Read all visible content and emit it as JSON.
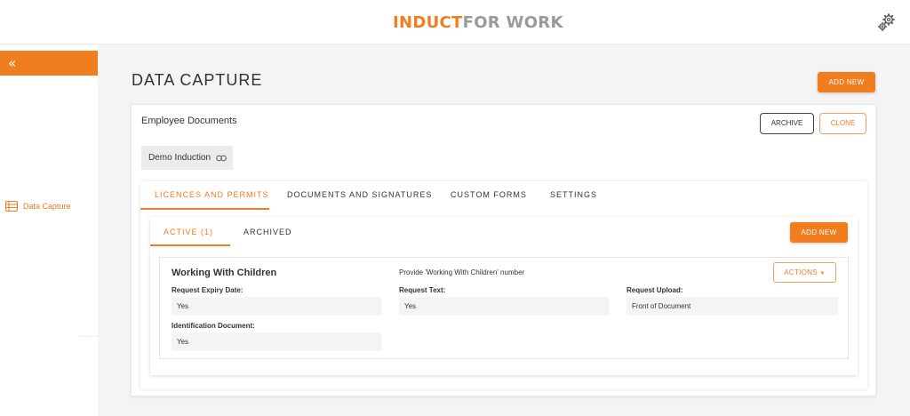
{
  "header": {
    "logo_part1": "INDUCT",
    "logo_part2": "FOR WORK",
    "settings_icon": "gears-icon"
  },
  "sidebar": {
    "collapse_glyph": "«",
    "items": [
      {
        "label": "Data Capture",
        "icon": "list-icon"
      }
    ]
  },
  "page": {
    "title": "DATA CAPTURE",
    "add_new_label": "ADD NEW"
  },
  "card": {
    "title": "Employee Documents",
    "archive_label": "ARCHIVE",
    "clone_label": "CLONE",
    "chip_label": "Demo Induction",
    "chip_icon": "link-icon"
  },
  "tabs": [
    {
      "label": "LICENCES AND PERMITS",
      "active": true
    },
    {
      "label": "DOCUMENTS AND SIGNATURES",
      "active": false
    },
    {
      "label": "CUSTOM FORMS",
      "active": false
    },
    {
      "label": "SETTINGS",
      "active": false
    }
  ],
  "subtabs": [
    {
      "label": "ACTIVE  (1)",
      "active": true
    },
    {
      "label": "ARCHIVED",
      "active": false
    }
  ],
  "subpanel": {
    "add_new_label": "ADD NEW"
  },
  "item": {
    "title": "Working With Children",
    "description": "Provide 'Working With Children' number",
    "actions_label": "ACTIONS",
    "fields": [
      {
        "label": "Request Expiry Date:",
        "value": "Yes"
      },
      {
        "label": "Request Text:",
        "value": "Yes"
      },
      {
        "label": "Request Upload:",
        "value": "Front of Document"
      },
      {
        "label": "Identification Document:",
        "value": "Yes"
      }
    ]
  },
  "colors": {
    "accent": "#f07d1e",
    "logo_grey": "#9a9a9a",
    "background": "#f4f4f4"
  }
}
